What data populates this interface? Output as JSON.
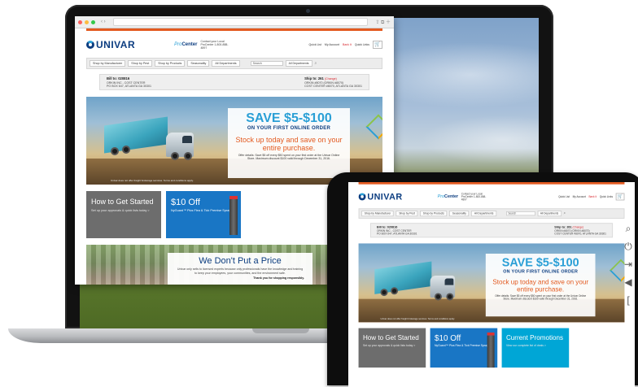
{
  "site": {
    "logo": "UNIVAR",
    "procenter_pro": "Pro",
    "procenter_center": "Center",
    "contact": "Contact your Local ProCenter 1-800-888-4897",
    "header_links": [
      "Quick List",
      "My Account",
      "Bank It",
      "Quick Links"
    ],
    "cart_icon": "cart-icon",
    "nav": [
      "Shop by Manufacturer",
      "Shop by Pest",
      "Shop by Products",
      "Seasonality",
      "All Departments"
    ],
    "search_placeholder": "Search",
    "dept_select": "All Departments",
    "bill_to": {
      "label": "Bill to: 020816",
      "line1": "ORKIN INC - COST CENTER",
      "line2": "PO BOX 647, ATLANTA GA 30301"
    },
    "ship_to": {
      "label": "Ship to: 261",
      "change": "(Change)",
      "line1": "ORKIN #8070 (ORKIN #8070)",
      "line2": "COST CENTER #8070, ATLANTA GA 30301"
    },
    "hero": {
      "save_prefix": "SAVE ",
      "save_range": "$5-$100",
      "first_order": "ON YOUR FIRST ONLINE ORDER",
      "stock_up": "Stock up today and save on your entire purchase.",
      "offer": "Offer details: Save $5 off every $50 spent on your first order at the Univar Online Store. Maximum discount $100 valid through December 31, 2016.",
      "caption": "Univar does not offer freight brokerage services. Terms and conditions apply."
    },
    "tiles": {
      "started_title": "How to Get Started",
      "started_sub": "Set up your approvals & quick lists today >",
      "offer_big": "$10 Off",
      "offer_small": "NyGuard™ Plus Flea & Tick Premise Spray >",
      "promos_title": "Current Promotions",
      "promos_sub": "View our complete list of deals >"
    },
    "price": {
      "title": "We Don't Put a Price",
      "text": "Univar only sells to licensed experts because only professionals have the knowledge and training to keep your employees, your communities, and the environment safe.",
      "thanks": "Thank you for shopping responsibly."
    }
  },
  "browser": {
    "url": ""
  },
  "side_icons": [
    "search-icon",
    "power-icon",
    "logout-icon",
    "back-icon",
    "bracket-icon"
  ],
  "colors": {
    "brand_navy": "#0c3d80",
    "brand_blue": "#2a9fd6",
    "accent_orange": "#e35a20",
    "tile_gray": "#6d6d6d",
    "tile_blue": "#1976c5",
    "tile_cyan": "#00a6d6"
  }
}
